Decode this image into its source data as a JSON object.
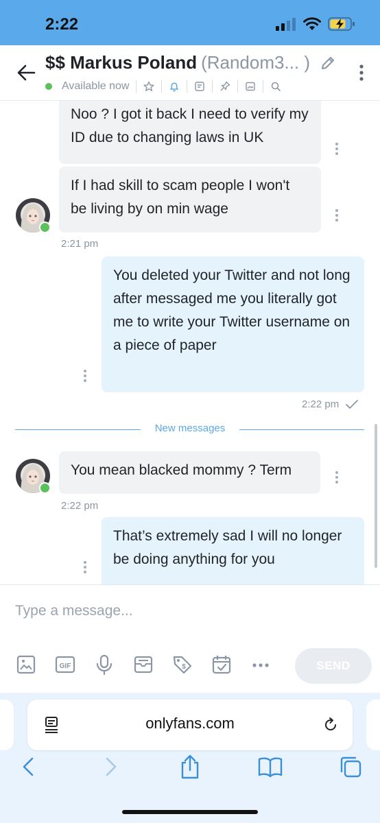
{
  "status_bar": {
    "time": "2:22"
  },
  "header": {
    "title": "$$ Markus Poland",
    "username": "(Random3... )",
    "availability": "Available now"
  },
  "messages": [
    {
      "side": "in",
      "text": "Noo ? I got it back I need to verify my ID due to changing laws in UK"
    },
    {
      "side": "in",
      "text": "If I had skill to scam people I won't be living by on min wage"
    },
    {
      "side": "in-time",
      "text": "2:21 pm"
    },
    {
      "side": "out",
      "text": "You deleted your Twitter and not long after messaged me you literally got me to write your Twitter username on a piece of paper"
    },
    {
      "side": "out-time",
      "text": "2:22 pm"
    },
    {
      "side": "in",
      "text": "You mean blacked mommy ? Term"
    },
    {
      "side": "in-time",
      "text": "2:22 pm"
    },
    {
      "side": "out",
      "text": "That’s extremely sad I will no longer be doing anything for you"
    }
  ],
  "divider": {
    "label": "New messages"
  },
  "composer": {
    "placeholder": "Type a message...",
    "send_label": "SEND",
    "tools": [
      "image-icon",
      "gif-icon",
      "microphone-icon",
      "vault-icon",
      "price-tag-icon",
      "schedule-icon",
      "more-icon"
    ]
  },
  "browser": {
    "url": "onlyfans.com"
  },
  "colors": {
    "accent": "#5aa9ea",
    "online": "#5bc15a",
    "incoming_bubble": "#f1f2f4",
    "outgoing_bubble": "#e5f3fc",
    "muted": "#8a96a3"
  }
}
